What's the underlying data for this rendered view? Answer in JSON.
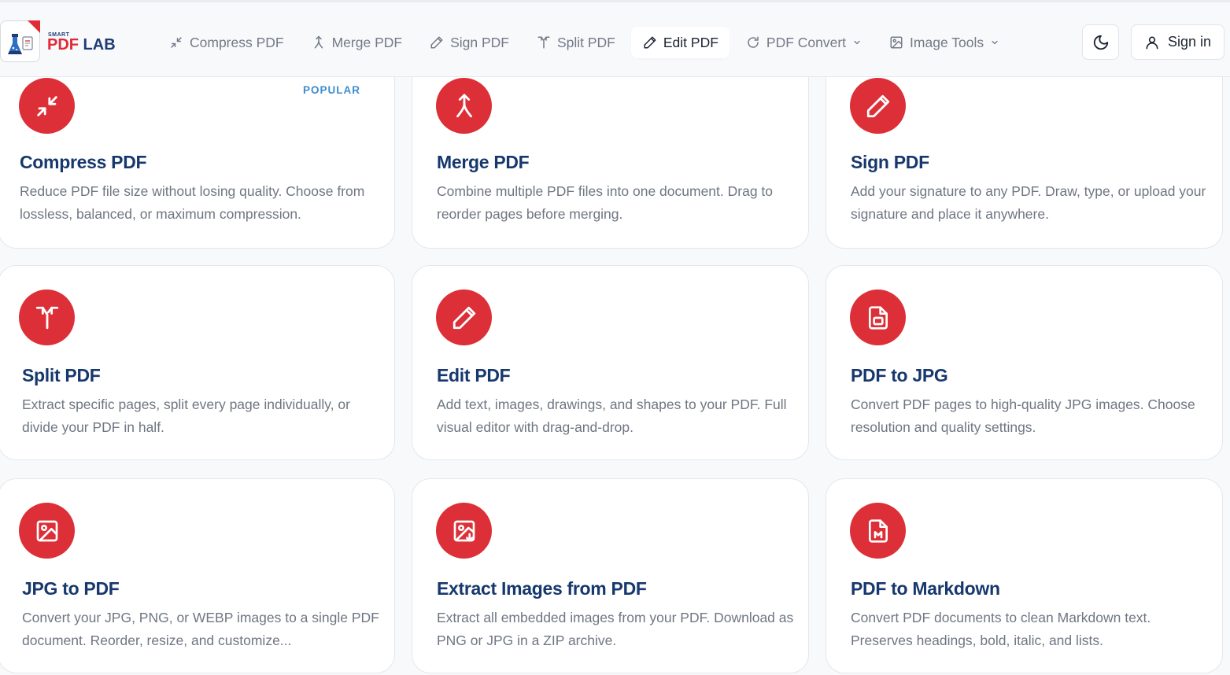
{
  "brand": {
    "small": "SMART",
    "pdf": "PDF",
    "lab": " LAB",
    "accent": "#dc2f37",
    "title_color": "#17386d"
  },
  "nav": {
    "items": [
      {
        "label": "Compress PDF",
        "icon": "compress-icon"
      },
      {
        "label": "Merge PDF",
        "icon": "merge-icon"
      },
      {
        "label": "Sign PDF",
        "icon": "pencil-icon"
      },
      {
        "label": "Split PDF",
        "icon": "split-icon"
      },
      {
        "label": "Edit PDF",
        "icon": "pencil-icon",
        "active": true
      },
      {
        "label": "PDF Convert",
        "icon": "refresh-icon",
        "dropdown": true
      },
      {
        "label": "Image Tools",
        "icon": "image-icon",
        "dropdown": true
      }
    ],
    "sign_in": "Sign in"
  },
  "cards": [
    {
      "title": "Compress PDF",
      "desc": "Reduce PDF file size without losing quality. Choose from lossless, balanced, or maximum compression.",
      "badge": "POPULAR",
      "icon": "compress-icon"
    },
    {
      "title": "Merge PDF",
      "desc": "Combine multiple PDF files into one document. Drag to reorder pages before merging.",
      "icon": "merge-icon"
    },
    {
      "title": "Sign PDF",
      "desc": "Add your signature to any PDF. Draw, type, or upload your signature and place it anywhere.",
      "icon": "pencil-icon"
    },
    {
      "title": "Split PDF",
      "desc": "Extract specific pages, split every page individually, or divide your PDF in half.",
      "icon": "split-icon"
    },
    {
      "title": "Edit PDF",
      "desc": "Add text, images, drawings, and shapes to your PDF. Full visual editor with drag-and-drop.",
      "icon": "pencil-icon"
    },
    {
      "title": "PDF to JPG",
      "desc": "Convert PDF pages to high-quality JPG images. Choose resolution and quality settings.",
      "icon": "file-image-icon"
    },
    {
      "title": "JPG to PDF",
      "desc": "Convert your JPG, PNG, or WEBP images to a single PDF document. Reorder, resize, and customize...",
      "icon": "image-icon"
    },
    {
      "title": "Extract Images from PDF",
      "desc": "Extract all embedded images from your PDF. Download as PNG or JPG in a ZIP archive.",
      "icon": "image-extract-icon"
    },
    {
      "title": "PDF to Markdown",
      "desc": "Convert PDF documents to clean Markdown text. Preserves headings, bold, italic, and lists.",
      "icon": "file-markdown-icon"
    }
  ]
}
